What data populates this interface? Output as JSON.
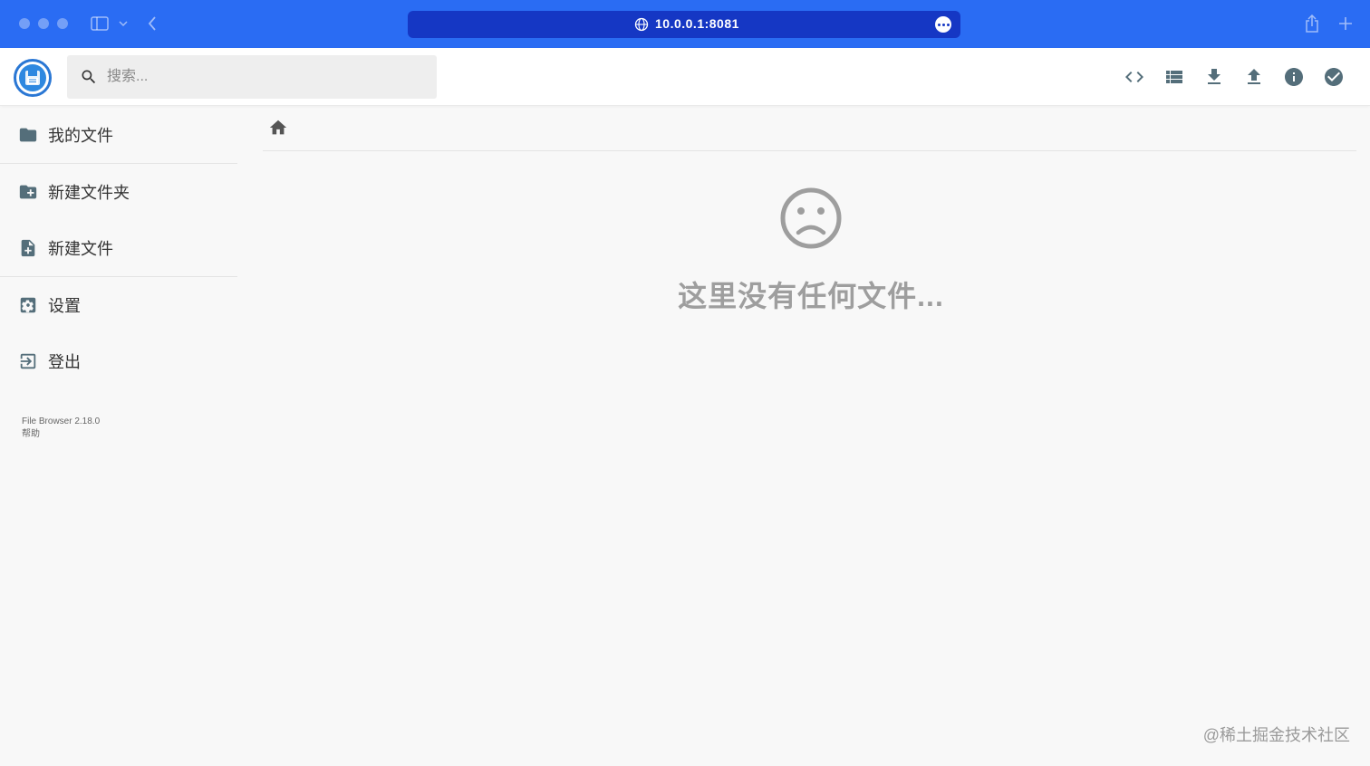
{
  "browser": {
    "url": "10.0.0.1:8081"
  },
  "header": {
    "search_placeholder": "搜索..."
  },
  "toolbar": {
    "icons": [
      "code-icon",
      "list-view-icon",
      "download-icon",
      "upload-icon",
      "info-icon",
      "check-circle-icon"
    ]
  },
  "sidebar": {
    "items": [
      {
        "label": "我的文件",
        "icon": "folder-icon"
      },
      {
        "label": "新建文件夹",
        "icon": "new-folder-icon"
      },
      {
        "label": "新建文件",
        "icon": "new-file-icon"
      },
      {
        "label": "设置",
        "icon": "settings-icon"
      },
      {
        "label": "登出",
        "icon": "logout-icon"
      }
    ],
    "version": "File Browser 2.18.0",
    "help": "帮助"
  },
  "main": {
    "empty_message": "这里没有任何文件..."
  },
  "watermark": "@稀土掘金技术社区",
  "colors": {
    "chrome_bar": "#2a6cf3",
    "address_bar": "#1537c4",
    "icon": "#546e7a",
    "logo": "#2e88e0"
  }
}
